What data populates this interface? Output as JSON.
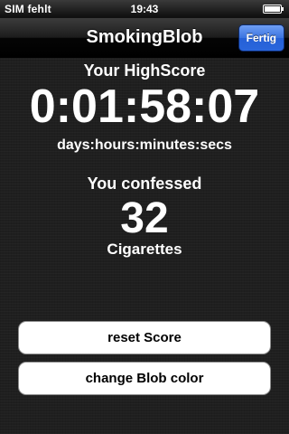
{
  "status_bar": {
    "carrier": "SIM fehlt",
    "time": "19:43",
    "battery_icon": "battery-full-icon"
  },
  "nav_bar": {
    "title": "SmokingBlob",
    "done_label": "Fertig"
  },
  "highscore": {
    "label": "Your HighScore",
    "value": "0:01:58:07",
    "format": "days:hours:minutes:secs"
  },
  "confessed": {
    "label": "You confessed",
    "count": "32",
    "unit": "Cigarettes"
  },
  "buttons": {
    "reset_label": "reset Score",
    "color_label": "change Blob color"
  },
  "colors": {
    "accent_blue": "#2a66dc",
    "background": "#1f1f1f",
    "text": "#ffffff"
  }
}
